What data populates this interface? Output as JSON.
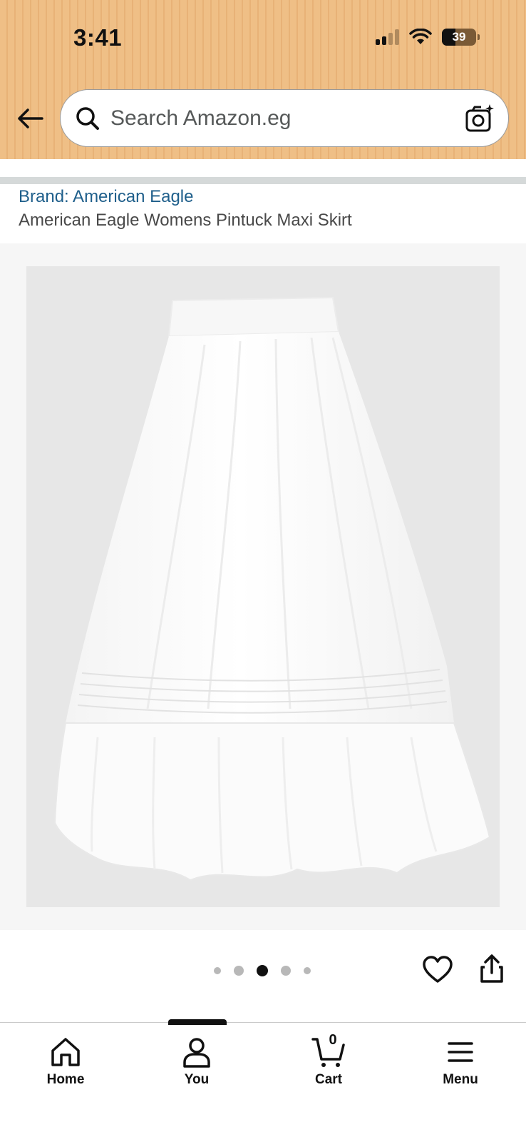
{
  "status_bar": {
    "time": "3:41",
    "battery_percent": "39",
    "signal_bars": 2
  },
  "header": {
    "back_icon": "arrow-left-icon",
    "search_placeholder": "Search Amazon.eg",
    "camera_icon": "camera-search-icon"
  },
  "product": {
    "brand": "Brand: American Eagle",
    "title": "American Eagle Womens Pintuck Maxi Skirt",
    "image_description_icon": "product-image",
    "image_count": 5,
    "active_image_index": 2
  },
  "actions": {
    "wishlist_icon": "heart-icon",
    "share_icon": "share-icon"
  },
  "tabbar": {
    "items": [
      {
        "label": "Home",
        "icon": "home-icon"
      },
      {
        "label": "You",
        "icon": "person-icon"
      },
      {
        "label": "Cart",
        "icon": "cart-icon",
        "count": "0"
      },
      {
        "label": "Menu",
        "icon": "menu-icon"
      }
    ],
    "active_index": 1
  },
  "colors": {
    "header_bg": "#efbf86",
    "brand_link": "#1f5f8b",
    "image_bg": "#e7e7e7"
  }
}
